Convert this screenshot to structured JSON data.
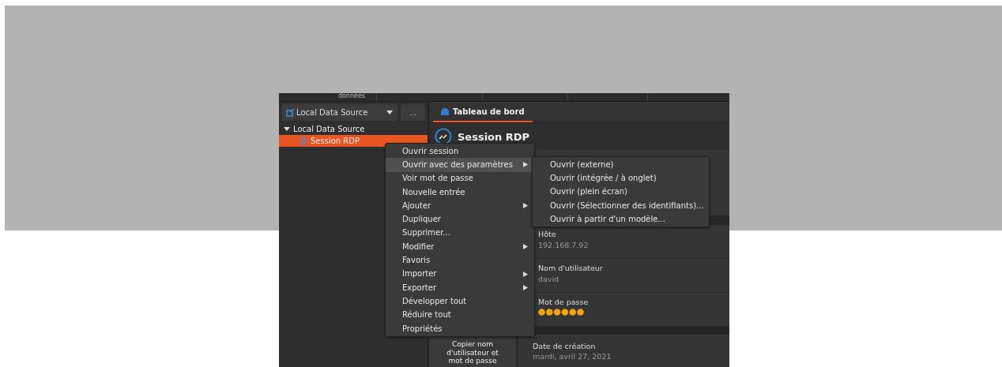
{
  "header_strip": {
    "column_1": "données"
  },
  "data_source": {
    "selector": "Local Data Source",
    "more_button": "..."
  },
  "tree": [
    {
      "label": "Local Data Source",
      "expanded": true,
      "selected": false,
      "children": [
        {
          "label": "Session RDP",
          "selected": true
        }
      ]
    }
  ],
  "tabs": [
    {
      "label": "Tableau de bord",
      "selected": true
    }
  ],
  "entry": {
    "title": "Session RDP"
  },
  "fields": [
    {
      "label": "Hôte",
      "value": "192.168.7.92",
      "kind": "text"
    },
    {
      "label": "Nom d'utilisateur",
      "value": "david",
      "kind": "text"
    },
    {
      "label": "Mot de passe",
      "kind": "password"
    }
  ],
  "copy_button": "Copier nom d'utilisateur et mot de passe",
  "created": {
    "label": "Date de création",
    "value": "mardi, avril 27, 2021"
  },
  "context_menu": [
    {
      "label": "Ouvrir session",
      "submenu": false,
      "selected": false
    },
    {
      "label": "Ouvrir avec des paramètres",
      "submenu": true,
      "selected": true
    },
    {
      "label": "Voir mot de passe",
      "submenu": false,
      "selected": false
    },
    {
      "label": "Nouvelle entrée",
      "submenu": false,
      "selected": false
    },
    {
      "label": "Ajouter",
      "submenu": true,
      "selected": false
    },
    {
      "label": "Dupliquer",
      "submenu": false,
      "selected": false
    },
    {
      "label": "Supprimer...",
      "submenu": false,
      "selected": false
    },
    {
      "label": "Modifier",
      "submenu": true,
      "selected": false
    },
    {
      "label": "Favoris",
      "submenu": false,
      "selected": false
    },
    {
      "label": "Importer",
      "submenu": true,
      "selected": false
    },
    {
      "label": "Exporter",
      "submenu": true,
      "selected": false
    },
    {
      "label": "Développer tout",
      "submenu": false,
      "selected": false
    },
    {
      "label": "Réduire tout",
      "submenu": false,
      "selected": false
    },
    {
      "label": "Propriétés",
      "submenu": false,
      "selected": false
    }
  ],
  "submenu": [
    {
      "label": "Ouvrir (externe)"
    },
    {
      "label": "Ouvrir (intégrée / à onglet)"
    },
    {
      "label": "Ouvrir (plein écran)"
    },
    {
      "label": "Ouvrir (Sélectionner des identifiants)..."
    },
    {
      "label": "Ouvrir à partir d'un modèle..."
    }
  ]
}
